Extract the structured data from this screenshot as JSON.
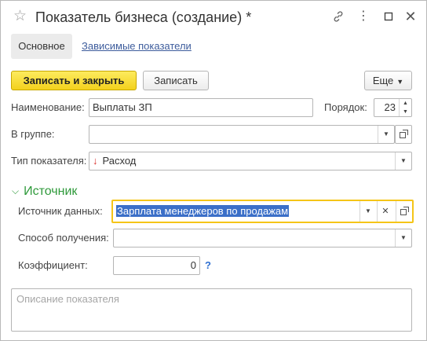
{
  "window": {
    "title": "Показатель бизнеса (создание) *",
    "icons": [
      "star-icon",
      "link-icon",
      "more-icon",
      "maximize-icon",
      "close-icon"
    ]
  },
  "tabs": {
    "main": "Основное",
    "dependent": "Зависимые показатели"
  },
  "toolbar": {
    "write_close_label": "Записать и закрыть",
    "write_label": "Записать",
    "more_label": "Еще"
  },
  "form": {
    "name_label": "Наименование:",
    "name_value": "Выплаты ЗП",
    "order_label": "Порядок:",
    "order_value": "23",
    "group_label": "В группе:",
    "group_value": "",
    "type_label": "Тип показателя:",
    "type_value": "Расход",
    "type_icon": "arrow-down-red-icon"
  },
  "source": {
    "section_title": "Источник",
    "data_source_label": "Источник данных:",
    "data_source_value": "Зарплата менеджеров по продажам",
    "method_label": "Способ получения:",
    "method_value": "",
    "coef_label": "Коэффициент:",
    "coef_value": "0",
    "help": "?"
  },
  "description": {
    "placeholder": "Описание показателя"
  },
  "colors": {
    "primary_button": "#f3d11d",
    "section_green": "#2f9a3b",
    "link_blue": "#3d5c9c",
    "focus_border": "#f5c518",
    "selection": "#3b6fc8",
    "expense_arrow": "#d9302c"
  }
}
